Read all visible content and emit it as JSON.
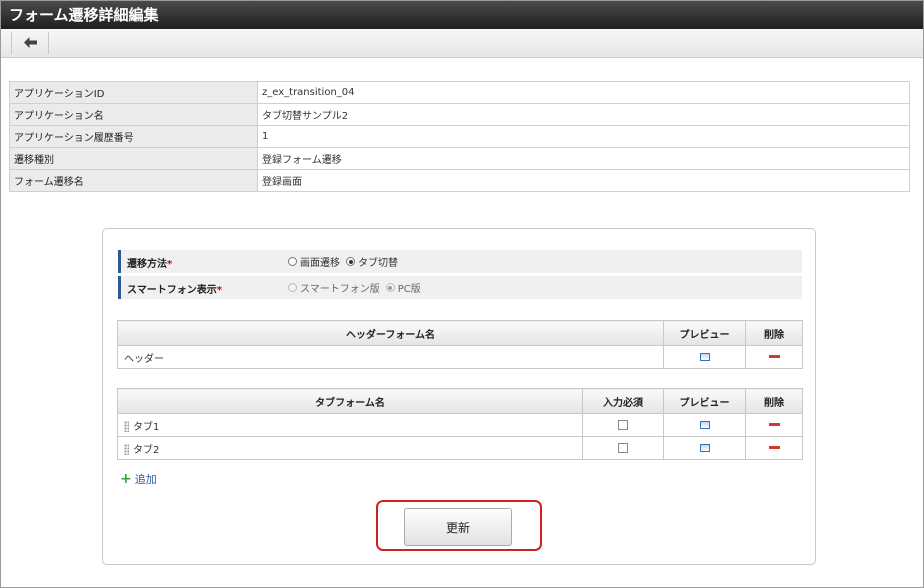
{
  "window": {
    "title": "フォーム遷移詳細編集"
  },
  "toolbar": {
    "back_icon": "arrow-left-icon"
  },
  "info": {
    "rows": [
      {
        "label": "アプリケーションID",
        "value": "z_ex_transition_04"
      },
      {
        "label": "アプリケーション名",
        "value": "タブ切替サンプル2"
      },
      {
        "label": "アプリケーション履歴番号",
        "value": "1"
      },
      {
        "label": "遷移種別",
        "value": "登録フォーム遷移"
      },
      {
        "label": "フォーム遷移名",
        "value": "登録画面"
      }
    ]
  },
  "settings": {
    "transition_method": {
      "label": "遷移方法",
      "required_mark": "*",
      "options": [
        "画面遷移",
        "タブ切替"
      ],
      "selected": "タブ切替"
    },
    "smartphone_display": {
      "label": "スマートフォン表示",
      "required_mark": "*",
      "options": [
        "スマートフォン版",
        "PC版"
      ],
      "selected": "PC版",
      "disabled": true
    }
  },
  "header_table": {
    "columns": [
      "ヘッダーフォーム名",
      "プレビュー",
      "削除"
    ],
    "rows": [
      {
        "name": "ヘッダー"
      }
    ]
  },
  "tab_table": {
    "columns": [
      "タブフォーム名",
      "入力必須",
      "プレビュー",
      "削除"
    ],
    "rows": [
      {
        "name": "タブ1",
        "required": false
      },
      {
        "name": "タブ2",
        "required": false
      }
    ]
  },
  "actions": {
    "add_label": "追加",
    "update_label": "更新"
  },
  "colors": {
    "titlebar": "#2b2b2b",
    "accent": "#2c5b8f",
    "required": "#d00000",
    "delete": "#d33a2a",
    "highlight": "#cc2222"
  }
}
